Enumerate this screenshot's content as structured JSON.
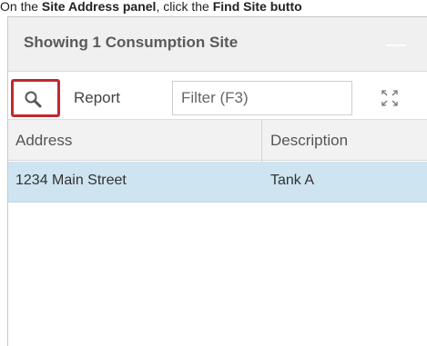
{
  "instruction": {
    "prefix": "On the ",
    "panel_name": "Site Address panel",
    "middle": ", click the ",
    "button_name": "Find Site butto"
  },
  "panel": {
    "title": "Showing 1 Consumption Site"
  },
  "toolbar": {
    "search_icon": "search-icon",
    "report_label": "Report",
    "filter_value": "",
    "filter_placeholder": "Filter (F3)",
    "expand_icon": "expand-icon"
  },
  "grid": {
    "columns": [
      "Address",
      "Description"
    ],
    "rows": [
      {
        "address": "1234 Main Street",
        "description": "Tank A",
        "selected": true
      }
    ]
  },
  "colors": {
    "highlight_border": "#c0282e",
    "selected_row": "#cfe4f1",
    "header_bg": "#f0f0f0"
  }
}
